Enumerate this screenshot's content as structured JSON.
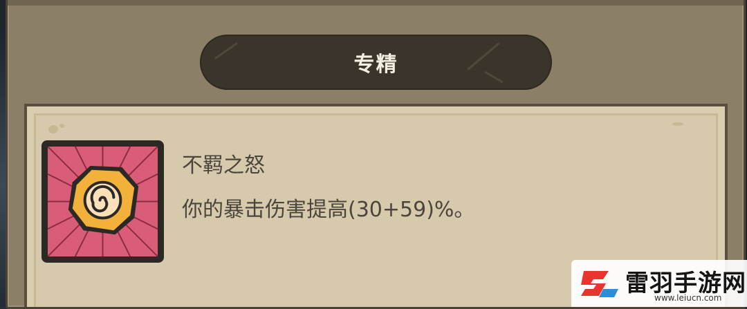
{
  "header": {
    "title": "专精"
  },
  "skill": {
    "icon": "spiral-gem-icon",
    "name": "不羁之怒",
    "description": "你的暴击伤害提高(30+59)%。"
  },
  "watermark": {
    "text": "雷羽手游网",
    "url": "www.leiucn.com"
  },
  "colors": {
    "panel": "#8b7f67",
    "pill": "#3b342b",
    "card": "#d9ccaf",
    "icon_bg": "#d95d79",
    "icon_gem": "#f2b13a",
    "text": "#4a453d",
    "logo_red": "#e8332f",
    "logo_blue": "#2a8fd8"
  }
}
